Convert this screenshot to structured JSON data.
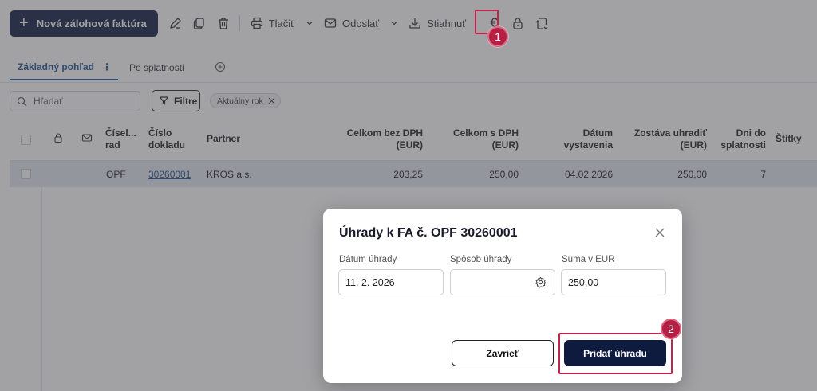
{
  "toolbar": {
    "new_invoice_label": "Nová zálohová faktúra",
    "print_label": "Tlačiť",
    "send_label": "Odoslať",
    "download_label": "Stiahnuť"
  },
  "annotations": {
    "step1": "1",
    "step2": "2",
    "highlight_color": "#c0234b"
  },
  "tabs": {
    "basic_view": "Základný pohľad",
    "due": "Po splatnosti"
  },
  "search": {
    "placeholder": "Hľadať"
  },
  "filters": {
    "button_label": "Filtre",
    "chip_label": "Aktuálny rok"
  },
  "table": {
    "headers": {
      "series": "Čísel... rad",
      "doc_number": "Číslo dokladu",
      "partner": "Partner",
      "total_excl_vat": "Celkom bez DPH (EUR)",
      "total_incl_vat": "Celkom s DPH (EUR)",
      "issue_date": "Dátum vystavenia",
      "remaining": "Zostáva uhradiť (EUR)",
      "days_due": "Dni do splatnosti",
      "tags": "Štítky"
    },
    "rows": [
      {
        "series": "OPF",
        "doc_number": "30260001",
        "partner": "KROS a.s.",
        "total_excl_vat": "203,25",
        "total_incl_vat": "250,00",
        "issue_date": "04.02.2026",
        "remaining": "250,00",
        "days_due": "7"
      }
    ]
  },
  "dialog": {
    "title": "Úhrady k FA č. OPF 30260001",
    "payment_date_label": "Dátum úhrady",
    "payment_date_value": "11. 2. 2026",
    "payment_method_label": "Spôsob úhrady",
    "payment_method_value": "",
    "amount_label": "Suma v EUR",
    "amount_value": "250,00",
    "close_label": "Zavrieť",
    "add_payment_label": "Pridať úhradu"
  },
  "colors": {
    "primary": "#0f1a3f",
    "link": "#1d4f91",
    "row_selected": "#e3e6f1"
  }
}
